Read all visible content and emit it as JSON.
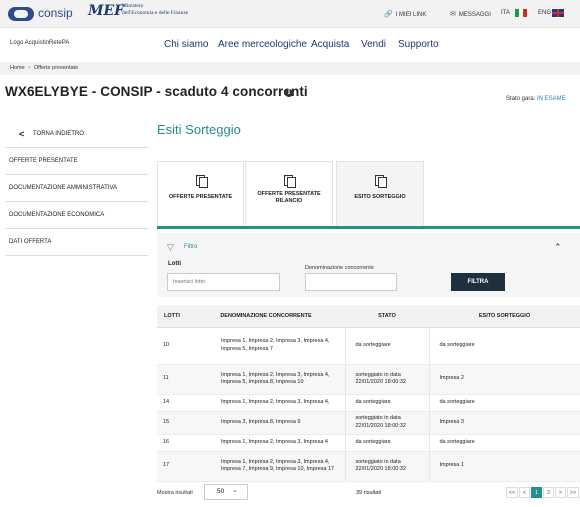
{
  "header": {
    "consip": "consip",
    "mef_logo": "MEF",
    "mef_line1": "Ministero",
    "mef_line2": "dell'Economia e delle Finanze",
    "links": [
      {
        "label": "I MIEI LINK",
        "icon": "link-icon"
      },
      {
        "label": "MESSAGGI",
        "icon": "envelope-icon"
      },
      {
        "label": "ITA"
      },
      {
        "label": "ENG"
      }
    ]
  },
  "nav": {
    "brand": "Logo AcquistinRetePA",
    "items": [
      "Chi siamo",
      "Aree merceologiche",
      "Acquista",
      "Vendi",
      "Supporto"
    ]
  },
  "breadcrumb": [
    "Home",
    "Offerte presentate"
  ],
  "page": {
    "title": "WX6ELYBYE - CONSIP - scaduto 4 concorrenti",
    "info_icon": "i",
    "stato_label": "Stato gara:",
    "stato_value": "IN ESAME"
  },
  "sidebar": {
    "back_label": "TORNA INDIETRO",
    "items": [
      "OFFERTE  PRESENTATE",
      "DOCUMENTAZIONE  AMMINISTRATIVA",
      "DOCUMENTAZIONE  ECONOMICA",
      "DATI OFFERTA"
    ]
  },
  "main": {
    "title": "Esiti Sorteggio",
    "tabs": [
      "OFFERTE PRESENTATE",
      "OFFERTE PRESENTATE RILANCIO",
      "ESITO SORTEGGIO"
    ],
    "filter": {
      "label": "Filtro",
      "lotti_label": "Lotti",
      "lotti_placeholder": "Inserisci lotto",
      "denom_label": "Denominazione concorrente",
      "button": "FILTRA"
    },
    "table": {
      "headers": [
        "LOTTI",
        "DENOMINAZIONE CONCORRENTE",
        "STATO",
        "ESITO SORTEGGIO"
      ],
      "rows": [
        {
          "lotto": "10",
          "den1": "Impresa 1, Impresa 2, Impresa 3, Impresa 4,",
          "den2": "Impresa 5, Impresa 7",
          "stato1": "da sorteggiare",
          "stato2": "",
          "esito": "da sorteggiare"
        },
        {
          "lotto": "11",
          "den1": "Impresa 1, Impresa 2, Impresa 3, Impresa 4,",
          "den2": "Impresa 5, Impresa 8, Impresa 10",
          "stato1": "sorteggiato in data",
          "stato2": "22/01/2020 18:00:32",
          "esito": "Impresa 2"
        },
        {
          "lotto": "14",
          "den1": "Impresa 1, Impresa 2, Impresa 3, Impresa 4,",
          "den2": "",
          "stato1": "da sorteggiare",
          "stato2": "",
          "esito": "da sorteggiare"
        },
        {
          "lotto": "15",
          "den1": "Impresa 3, Impresa 8, Impresa 9",
          "den2": "",
          "stato1": "sorteggiato in data",
          "stato2": "22/01/2020 18:00:32",
          "esito": "Impresa 3"
        },
        {
          "lotto": "16",
          "den1": "Impresa 1, Impresa 2, Impresa 3, Impresa 4",
          "den2": "",
          "stato1": "da sorteggiare",
          "stato2": "",
          "esito": "da sorteggiare"
        },
        {
          "lotto": "17",
          "den1": "Impresa 1, Impresa 2, Impresa 3, Impresa 4,",
          "den2": "Impresa 7, Impresa 9, Impresa 10, Impresa 17",
          "stato1": "sorteggiato in data",
          "stato2": "22/01/2020 18:00:32",
          "esito": "Impresa 1"
        }
      ]
    },
    "footer": {
      "mostra_label": "Mostra risultati",
      "mostra_value": "50",
      "risultati": "39 risultati",
      "pager": [
        "<<",
        "<",
        "1",
        "2",
        ">",
        ">>"
      ],
      "current_page": "1"
    }
  }
}
